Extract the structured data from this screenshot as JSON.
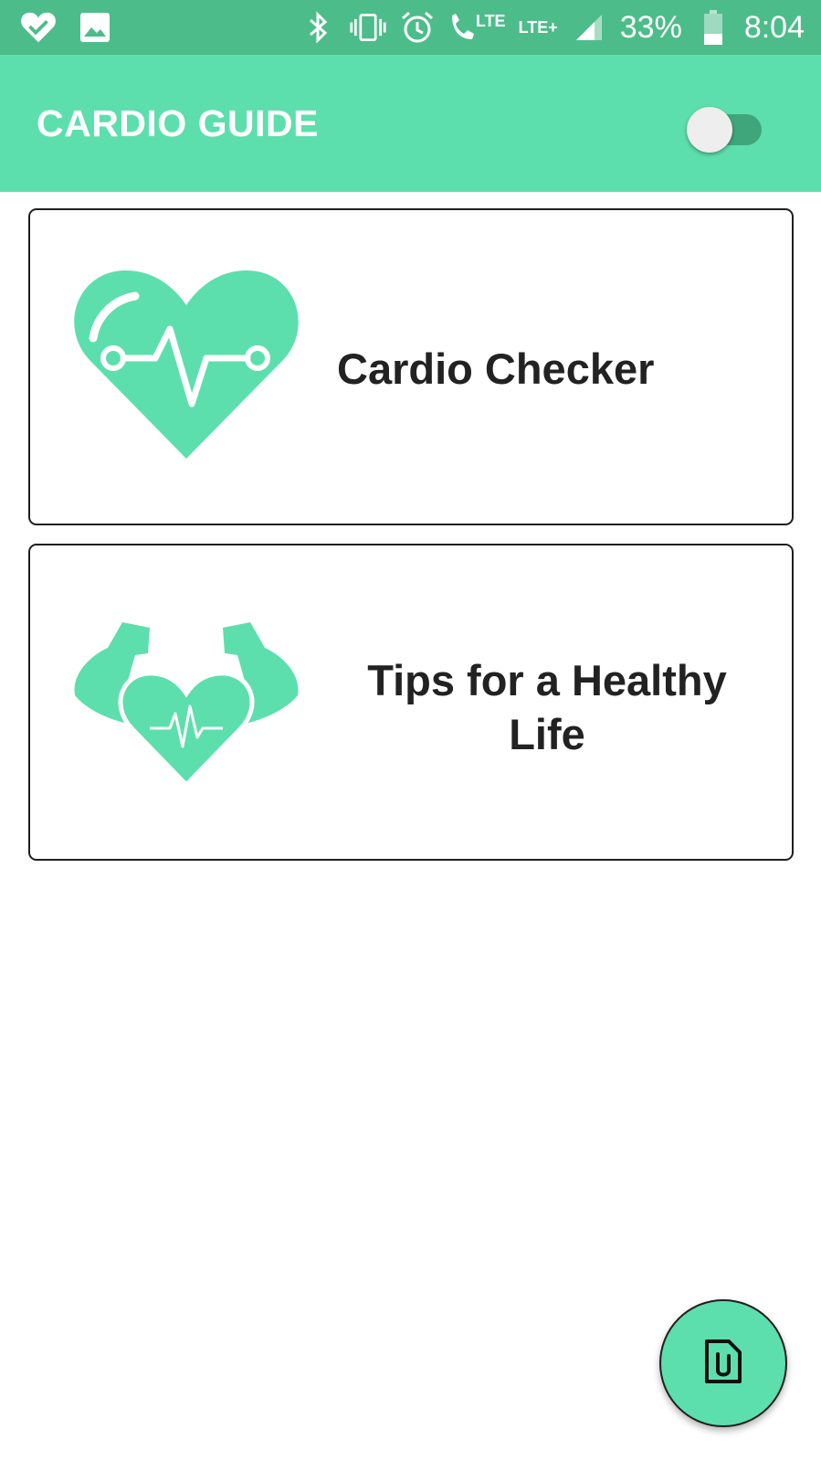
{
  "status_bar": {
    "icons_left": [
      "heart-check-icon",
      "image-icon"
    ],
    "icons_right": [
      "bluetooth-icon",
      "vibrate-icon",
      "alarm-icon",
      "volte-call-icon",
      "signal-icon",
      "battery-icon"
    ],
    "lte_call_label": "LTE",
    "lte_plus_label": "LTE+",
    "battery_percent": "33%",
    "time": "8:04"
  },
  "app_bar": {
    "title": "CARDIO GUIDE",
    "toggle_on": false
  },
  "cards": [
    {
      "label": "Cardio Checker",
      "icon": "heart-pulse-icon"
    },
    {
      "label": "Tips for a Healthy Life",
      "icon": "strong-heart-icon"
    }
  ],
  "fab": {
    "icon": "attachment-file-icon"
  },
  "colors": {
    "status_bar": "#4dbc8b",
    "app_bar": "#5ddfad",
    "accent": "#5ddfad",
    "text": "#222222"
  }
}
